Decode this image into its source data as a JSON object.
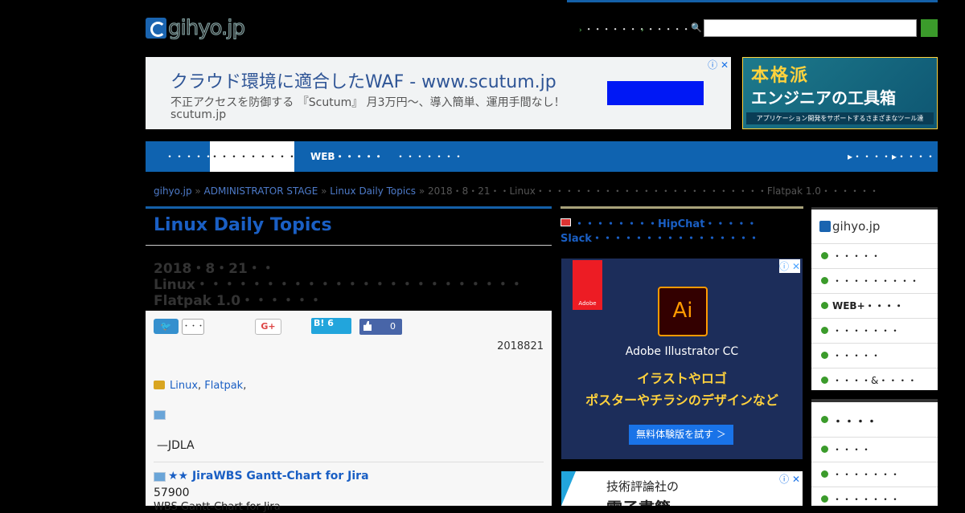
{
  "header": {
    "logo_text": "gihyo.jp",
    "links": [
      "・・・・・・・",
      "・・・・・"
    ],
    "search": {
      "placeholder": ""
    }
  },
  "ad_banner": {
    "title": "クラウド環境に適合したWAF - www.scutum.jp",
    "description": "不正アクセスを防御する 『Scutum』 月3万円〜、導入簡単、運用手間なし！",
    "domain": "scutum.jp",
    "close": "ⓘ ✕"
  },
  "ad_tools": {
    "line1": "本格派",
    "line2": "エンジニアの工具箱",
    "line3": "アプリケーション開発をサポートするさまざまなツール達"
  },
  "nav": {
    "items": [
      "・・・・・",
      "・・・・・・・・・",
      "WEB・・・・・",
      "・・・・・・・"
    ],
    "right_items": [
      "▸・・・・",
      "▸・・・・"
    ]
  },
  "breadcrumb": {
    "home": "gihyo.jp",
    "sep": " » ",
    "level1": "ADMINISTRATOR STAGE",
    "level2": "Linux Daily Topics",
    "current": "2018・8・21・・Linux・・・・・・・・・・・・・・・・・・・・・・・・Flatpak 1.0・・・・・・"
  },
  "main": {
    "section_title": "Linux Daily Topics",
    "article_title": "2018・8・21・・Linux・・・・・・・・・・・・・・・・・・・・・・・・Flatpak 1.0・・・・・・",
    "share": {
      "twitter": "🐦",
      "twitter_count": "・・・",
      "gplus": "G+",
      "hatena": "B! 6",
      "facebook_count": "0"
    },
    "date": "2018821",
    "tag1": "Linux",
    "tag_sep": ", ",
    "tag2": "Flatpak",
    "tag_end": ",",
    "author": "—JDLA",
    "related_title": "★★ JiraWBS Gantt-Chart for Jira",
    "related_number": "57900",
    "related_sub": "WBS Gantt-Chart for Jira"
  },
  "middle": {
    "headline": "・・・・・・・・HipChat・・・・・Slack・・・・・・・・・・・・・・・・",
    "ad_brand": "Adobe",
    "ad_icon": "Ai",
    "ad_product": "Adobe Illustrator CC",
    "ad_line1": "イラストやロゴ",
    "ad_line2": "ポスターやチラシのデザインなど",
    "ad_cta": "無料体験版を試す ＞",
    "ad2_line1": "技術評論社の",
    "ad2_line2": "電子書籍"
  },
  "sidebar": {
    "logo": "gihyo.jp",
    "items": [
      "・・・・・",
      "・・・・・・・・・",
      "WEB+・・・・",
      "・・・・・・・",
      "・・・・・",
      "・・・・&・・・・"
    ],
    "section2_title": "・・・・",
    "section2_items": [
      "・・・・",
      "・・・・・・・",
      "・・・・・・・"
    ]
  },
  "colors": {
    "brand_blue": "#0f63b0",
    "link_blue": "#1a5fc4",
    "accent_green": "#3b9b2b"
  }
}
